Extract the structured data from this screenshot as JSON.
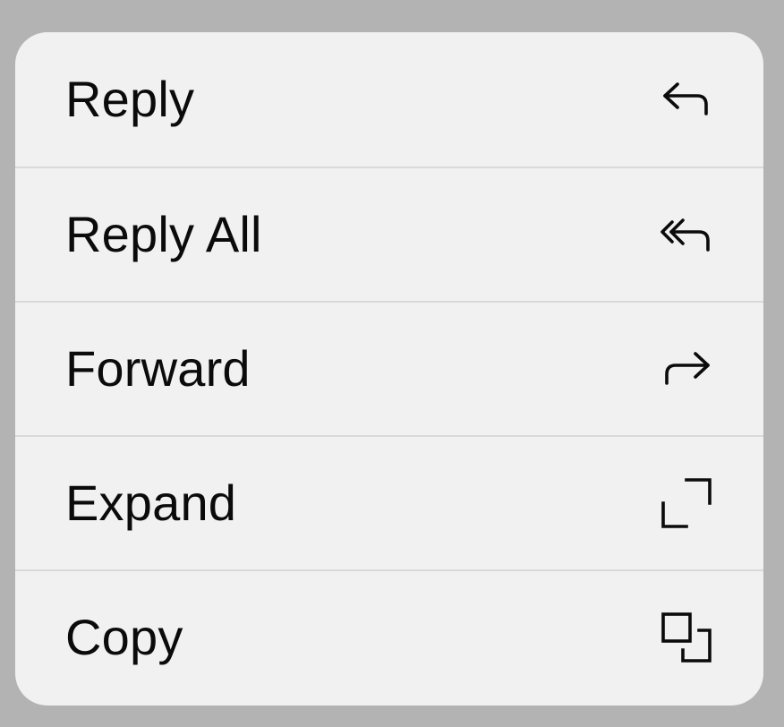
{
  "menu": {
    "items": [
      {
        "label": "Reply",
        "icon": "reply-icon"
      },
      {
        "label": "Reply All",
        "icon": "reply-all-icon"
      },
      {
        "label": "Forward",
        "icon": "forward-icon"
      },
      {
        "label": "Expand",
        "icon": "expand-icon"
      },
      {
        "label": "Copy",
        "icon": "copy-icon"
      }
    ]
  },
  "colors": {
    "backdrop": "#b3b3b3",
    "menu_background": "#f1f1f2",
    "separator": "#d9d9dc",
    "text": "#0b0b0b"
  }
}
